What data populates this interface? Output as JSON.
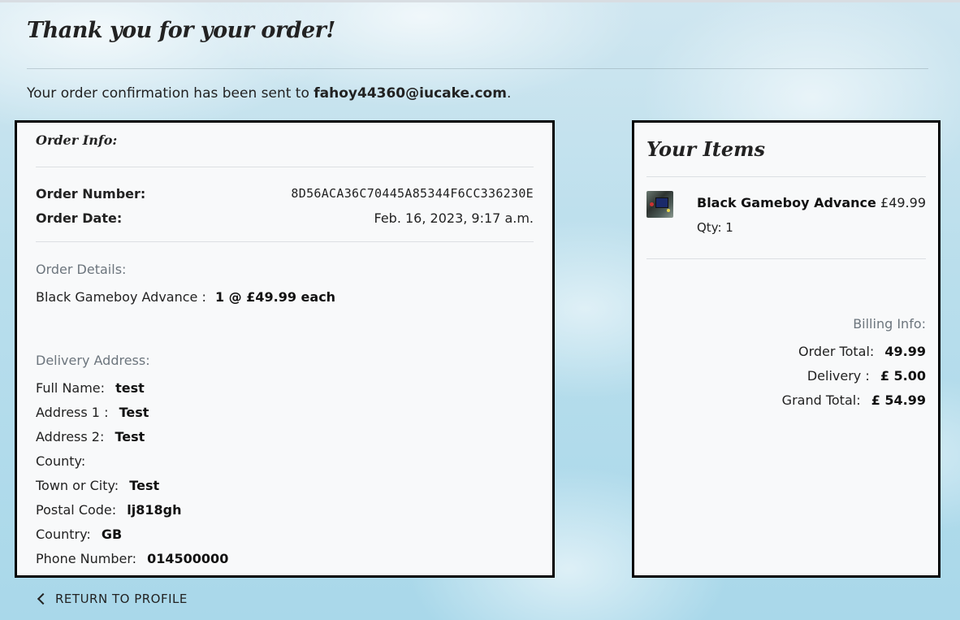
{
  "page": {
    "title": "Thank you for your order!",
    "confirmation_prefix": "Your order confirmation has been sent to ",
    "confirmation_email": "fahoy44360@iucake.com",
    "confirmation_suffix": "."
  },
  "order_info": {
    "heading": "Order Info:",
    "order_number_label": "Order Number:",
    "order_number": "8D56ACA36C70445A85344F6CC336230E",
    "order_date_label": "Order Date:",
    "order_date": "Feb. 16, 2023, 9:17 a.m.",
    "details_label": "Order Details:",
    "line_item_name": "Black Gameboy Advance :",
    "line_item_value": "1 @ £49.99 each",
    "delivery_label": "Delivery Address:",
    "full_name_label": "Full Name:",
    "full_name": "test",
    "address1_label": "Address 1 :",
    "address1": "Test",
    "address2_label": "Address 2:",
    "address2": "Test",
    "county_label": "County:",
    "county": "",
    "town_label": "Town or City:",
    "town": "Test",
    "postal_label": "Postal Code:",
    "postal": "lj818gh",
    "country_label": "Country:",
    "country": "GB",
    "phone_label": "Phone Number:",
    "phone": "014500000"
  },
  "items": {
    "heading": "Your Items",
    "list": [
      {
        "name": "Black Gameboy Advance",
        "qty": "Qty: 1",
        "price": "£49.99",
        "thumbnail_icon": "gameboy-thumbnail"
      }
    ],
    "billing_label": "Billing Info:",
    "order_total_label": "Order Total:",
    "order_total": "49.99",
    "delivery_label": "Delivery :",
    "delivery": "£ 5.00",
    "grand_total_label": "Grand Total:",
    "grand_total": "£ 54.99"
  },
  "nav": {
    "return_label": "RETURN TO PROFILE",
    "return_icon": "chevron-left-icon"
  }
}
